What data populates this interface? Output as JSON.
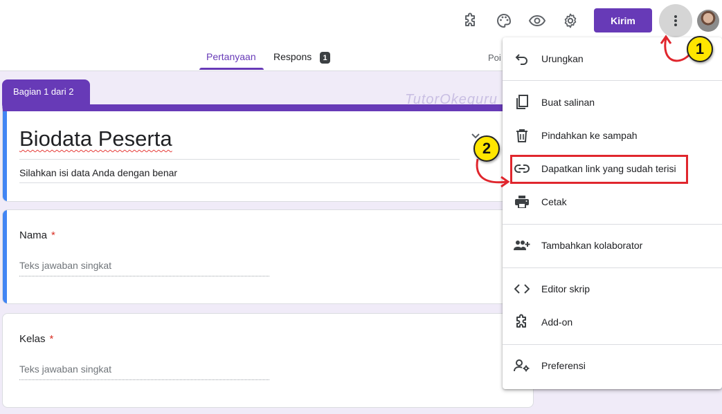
{
  "header": {
    "send_label": "Kirim",
    "icons": [
      "puzzle-icon",
      "palette-icon",
      "eye-icon",
      "gear-icon",
      "more-vert-icon"
    ]
  },
  "tabs": {
    "questions": "Pertanyaan",
    "responses": "Respons",
    "responses_count": "1",
    "points": "Poi"
  },
  "section": {
    "label": "Bagian 1 dari 2"
  },
  "watermark": "TutorOkeguru",
  "form": {
    "title": "Biodata Peserta",
    "description": "Silahkan isi data Anda dengan benar"
  },
  "questions": [
    {
      "label": "Nama",
      "required_mark": "*",
      "placeholder": "Teks jawaban singkat"
    },
    {
      "label": "Kelas",
      "required_mark": "*",
      "placeholder": "Teks jawaban singkat"
    }
  ],
  "menu": {
    "items": [
      {
        "label": "Urungkan",
        "icon": "undo-icon"
      },
      {
        "label": "Buat salinan",
        "icon": "copy-icon"
      },
      {
        "label": "Pindahkan ke sampah",
        "icon": "trash-icon"
      },
      {
        "label": "Dapatkan link yang sudah terisi",
        "icon": "link-icon"
      },
      {
        "label": "Cetak",
        "icon": "print-icon"
      },
      {
        "label": "Tambahkan kolaborator",
        "icon": "add-people-icon"
      },
      {
        "label": "Editor skrip",
        "icon": "code-icon"
      },
      {
        "label": "Add-on",
        "icon": "puzzle-icon"
      },
      {
        "label": "Preferensi",
        "icon": "person-settings-icon"
      }
    ]
  },
  "annotations": {
    "step1": "1",
    "step2": "2"
  },
  "colors": {
    "accent": "#673ab7",
    "background": "#f0ebf8",
    "highlight": "#e0262d",
    "bubble": "#ffe600"
  }
}
